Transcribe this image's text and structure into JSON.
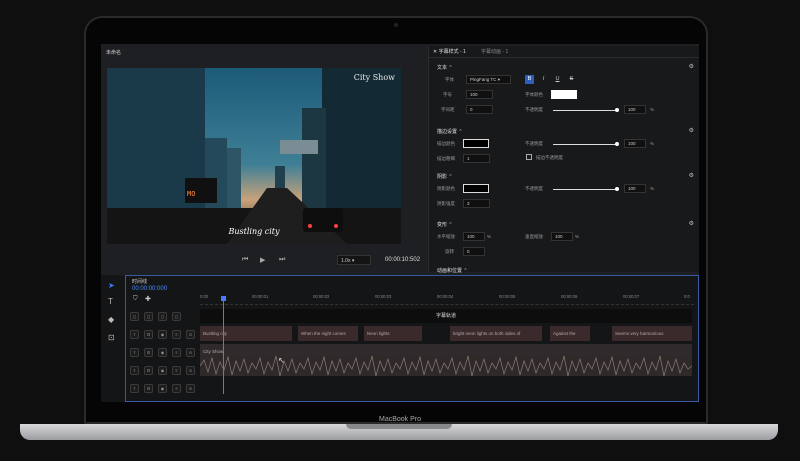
{
  "device": {
    "brand_label": "MacBook Pro"
  },
  "app": {
    "preview_panel_title": "未命名",
    "video": {
      "overlay_title": "City Show",
      "caption": "Bustling city"
    },
    "player": {
      "speed": "1.0x",
      "timecode": "00:00:10:502"
    },
    "props": {
      "tab_active": "字幕样式 - 1",
      "tab_inactive": "字幕动画 - 1",
      "text_section": {
        "title": "文本",
        "font_label": "字体",
        "font_value": "PingFang TC",
        "font_color_label": "字体颜色",
        "font_size_label": "字号",
        "font_size_value": "100",
        "spacing_label": "字间距",
        "spacing_value": "0",
        "opacity_label": "不透明度",
        "opacity_value": "100",
        "unit": "%",
        "format_buttons": [
          "B",
          "I",
          "U",
          "S"
        ]
      },
      "stroke_section": {
        "title": "描边设置",
        "color_label": "描边颜色",
        "opacity_label": "不透明度",
        "opacity_value": "100",
        "thickness_label": "描边粗细",
        "thickness_value": "1",
        "checkbox_label": "描边不透明度"
      },
      "shadow_section": {
        "title": "阴影",
        "color_label": "阴影颜色",
        "opacity_label": "不透明度",
        "opacity_value": "100",
        "blur_label": "阴影强度",
        "blur_value": "3"
      },
      "transform_section": {
        "title": "变形",
        "hscale_label": "水平缩放",
        "hscale_value": "100",
        "vscale_label": "垂直缩放",
        "vscale_value": "100",
        "rotate_label": "旋转",
        "rotate_value": "0"
      },
      "bottom_section_title": "动画和位置"
    },
    "timeline": {
      "title": "时间线",
      "timecode": "00:00:00:000",
      "ruler_labels": [
        "0:00",
        "00:00:01",
        "00:00:02",
        "00:00:03",
        "00:00:04",
        "00:00:05",
        "00:00:06",
        "00:00:07",
        "0:0"
      ],
      "subtitle_track_label": "字幕轨道",
      "clips": [
        {
          "text": "Bustling city"
        },
        {
          "text": "When the night comes"
        },
        {
          "text": "Neon lights"
        },
        {
          "text": "bright neon lights on both sides of"
        },
        {
          "text": "Against the"
        },
        {
          "text": "Seems very harmonious"
        }
      ],
      "clip2": "City Show"
    }
  }
}
